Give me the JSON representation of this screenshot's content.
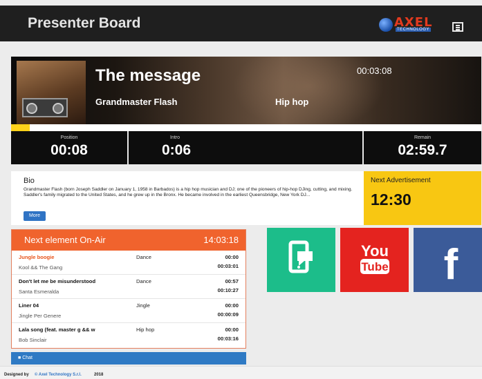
{
  "header": {
    "title": "Presenter Board",
    "logo_text": "AXEL",
    "logo_sub": "TECHNOLOGY"
  },
  "now_playing": {
    "title": "The message",
    "artist": "Grandmaster Flash",
    "genre": "Hip hop",
    "time": "00:03:08",
    "progress": 0.04
  },
  "counters": {
    "position": {
      "label": "Position",
      "value": "00:08"
    },
    "intro": {
      "label": "Intro",
      "value": "0:06"
    },
    "remain": {
      "label": "Remain",
      "value": "02:59.7"
    }
  },
  "bio": {
    "heading": "Bio",
    "text": "Grandmaster Flash (born Joseph Saddler on January 1, 1958 in Barbados) is a hip hop musician and DJ; one of the pioneers of hip-hop DJing, cutting, and mixing. Saddler's family migrated to the United States, and he grew up in the Bronx. He became involved in the earliest Queensbridge, New York DJ...",
    "more_label": "More"
  },
  "advertisement": {
    "heading": "Next Advertisement",
    "time": "12:30"
  },
  "on_air": {
    "heading": "Next element On-Air",
    "time": "14:03:18",
    "rows": [
      {
        "title": "Jungle boogie",
        "artist": "Kool && The Gang",
        "genre": "Dance",
        "duration": "00:00",
        "start": "00:03:01"
      },
      {
        "title": "Don't let me be misunderstood",
        "artist": "Santa Esmeralda",
        "genre": "Dance",
        "duration": "00:57",
        "start": "00:10:27"
      },
      {
        "title": "Liner 04",
        "artist": "Jingle Per Genere",
        "genre": "Jingle",
        "duration": "00:00",
        "start": "00:00:09"
      },
      {
        "title": "Lala song (feat. master g && w",
        "artist": "Bob Sinclair",
        "genre": "Hip hop",
        "duration": "00:00",
        "start": "00:03:16"
      }
    ]
  },
  "chat": {
    "label": "Chat"
  },
  "social": {
    "youtube_top": "You",
    "youtube_bottom": "Tube",
    "facebook": "f",
    "app_color": "#1cbd8a",
    "youtube_color": "#e4231f",
    "facebook_color": "#3b5b99"
  },
  "footer": {
    "prefix": "Designed by",
    "company": "© Axel Technology S.r.l.",
    "year": "2018"
  }
}
